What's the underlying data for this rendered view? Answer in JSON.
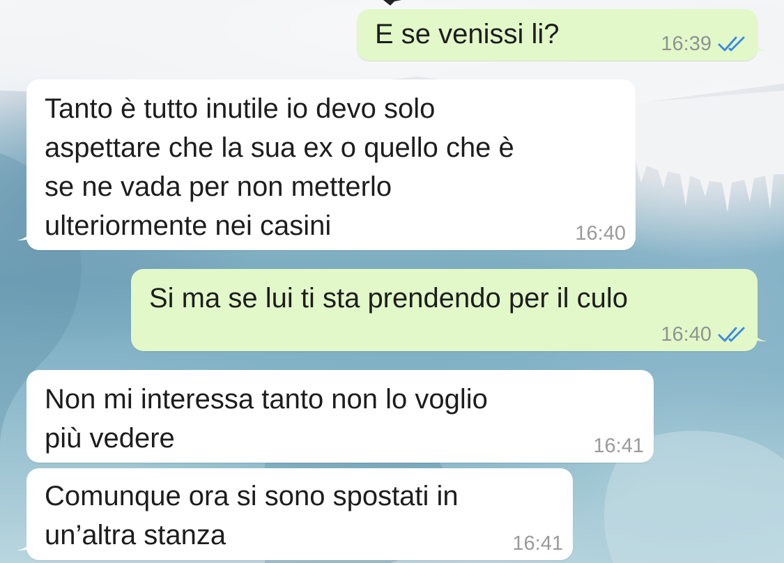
{
  "conversation": {
    "messages": [
      {
        "id": "msg-1",
        "direction": "outgoing",
        "text": "E se venissi li?",
        "time": "16:39",
        "status": "read",
        "status_icon": "double-check-icon"
      },
      {
        "id": "msg-2",
        "direction": "incoming",
        "text": "Tanto è tutto inutile io devo solo\naspettare che la sua ex o quello che è\nse ne vada per non metterlo\nulteriormente nei casini",
        "time": "16:40"
      },
      {
        "id": "msg-3",
        "direction": "outgoing",
        "text": "Si ma se lui ti sta prendendo per il culo",
        "time": "16:40",
        "status": "read",
        "status_icon": "double-check-icon"
      },
      {
        "id": "msg-4",
        "direction": "incoming",
        "text": "Non mi interessa tanto non lo voglio\npiù vedere",
        "time": "16:41"
      },
      {
        "id": "msg-5",
        "direction": "incoming",
        "text": "Comunque ora si sono spostati in\nun’altra stanza",
        "time": "16:41"
      }
    ]
  },
  "colors": {
    "outgoing_bubble": "#e2f8c9",
    "incoming_bubble": "#ffffff",
    "read_ticks": "#3b8be0",
    "timestamp": "#8e9490"
  }
}
